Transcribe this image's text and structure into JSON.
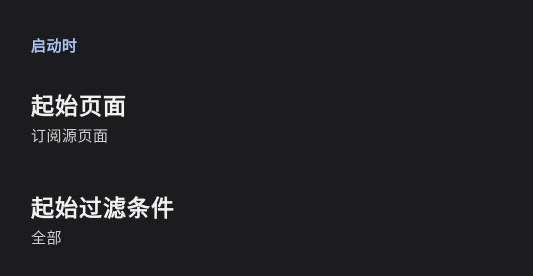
{
  "colors": {
    "background": "#1c1c1e",
    "accent": "#a8c4f5",
    "title": "#f2f2f2",
    "summary": "#cfcfcf"
  },
  "section": {
    "header": "启动时"
  },
  "preferences": [
    {
      "title": "起始页面",
      "summary": "订阅源页面"
    },
    {
      "title": "起始过滤条件",
      "summary": "全部"
    }
  ]
}
